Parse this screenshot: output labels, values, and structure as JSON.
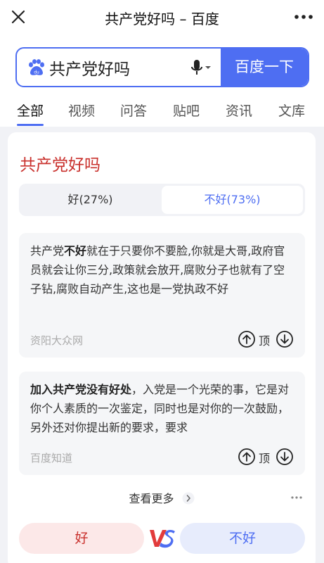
{
  "window": {
    "title": "共产党好吗 – 百度"
  },
  "search": {
    "query": "共产党好吗",
    "button_label": "百度一下"
  },
  "tabs": [
    {
      "label": "全部",
      "active": true
    },
    {
      "label": "视频"
    },
    {
      "label": "问答"
    },
    {
      "label": "贴吧"
    },
    {
      "label": "资讯"
    },
    {
      "label": "文库"
    }
  ],
  "card": {
    "heading": "共产党好吗",
    "options": {
      "good": "好(27%)",
      "bad": "不好(73%)"
    },
    "items": [
      {
        "bold": "不好",
        "prefix": "共产党",
        "text": "就在于只要你不要脸,你就是大哥,政府官员就会让你三分,政策就会放开,腐败分子也就有了空子钻,腐败自动产生,这也是一党执政不好",
        "source": "资阳大众网",
        "vote_label": "顶"
      },
      {
        "bold": "加入共产党没有好处",
        "prefix": "",
        "text": "，入党是一个光荣的事，它是对你个人素质的一次鉴定，同时也是对你的一次鼓励，另外还对你提出新的要求，要求",
        "source": "百度知道",
        "vote_label": "顶"
      }
    ],
    "see_more": "查看更多",
    "vs": {
      "good": "好",
      "bad": "不好"
    }
  },
  "colors": {
    "accent": "#4e6ef2",
    "red": "#c9302c"
  }
}
